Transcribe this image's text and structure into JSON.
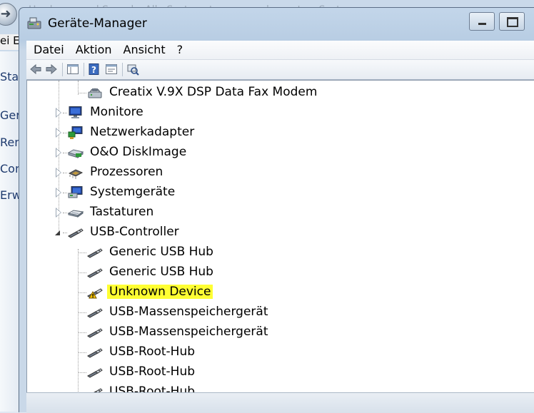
{
  "background": {
    "breadcrumb": "Hardware und Sound  ▸  Alle Systemsteuerungselemente  ▸  System",
    "menu_fragment": "ei   E",
    "side_items": [
      "Sta",
      "Ger",
      "Ren",
      "Con",
      "Erw"
    ]
  },
  "window": {
    "title": "Geräte-Manager",
    "icon": "device-manager-icon"
  },
  "menu": [
    "Datei",
    "Aktion",
    "Ansicht",
    "?"
  ],
  "toolbar": {
    "icons": [
      "back-arrow-icon",
      "forward-arrow-icon",
      "show-hide-console-tree-icon",
      "help-icon",
      "properties-icon",
      "scan-hardware-icon"
    ]
  },
  "tree": [
    {
      "label": "Creatix V.9X DSP Data Fax Modem",
      "level": 2,
      "icon": "modem-icon",
      "expander": "none"
    },
    {
      "label": "Monitore",
      "level": 1,
      "icon": "monitor-icon",
      "expander": "collapsed"
    },
    {
      "label": "Netzwerkadapter",
      "level": 1,
      "icon": "network-adapter-icon",
      "expander": "collapsed"
    },
    {
      "label": "O&O DiskImage",
      "level": 1,
      "icon": "disk-image-icon",
      "expander": "collapsed"
    },
    {
      "label": "Prozessoren",
      "level": 1,
      "icon": "processor-icon",
      "expander": "collapsed"
    },
    {
      "label": "Systemgeräte",
      "level": 1,
      "icon": "system-device-icon",
      "expander": "collapsed"
    },
    {
      "label": "Tastaturen",
      "level": 1,
      "icon": "keyboard-icon",
      "expander": "collapsed"
    },
    {
      "label": "USB-Controller",
      "level": 1,
      "icon": "usb-icon",
      "expander": "expanded"
    },
    {
      "label": "Generic USB Hub",
      "level": 2,
      "icon": "usb-icon",
      "expander": "none"
    },
    {
      "label": "Generic USB Hub",
      "level": 2,
      "icon": "usb-icon",
      "expander": "none"
    },
    {
      "label": "Unknown Device",
      "level": 2,
      "icon": "usb-warning-icon",
      "expander": "none",
      "highlighted": true,
      "highlight_color": "#ffff33"
    },
    {
      "label": "USB-Massenspeichergerät",
      "level": 2,
      "icon": "usb-icon",
      "expander": "none"
    },
    {
      "label": "USB-Massenspeichergerät",
      "level": 2,
      "icon": "usb-icon",
      "expander": "none"
    },
    {
      "label": "USB-Root-Hub",
      "level": 2,
      "icon": "usb-icon",
      "expander": "none"
    },
    {
      "label": "USB-Root-Hub",
      "level": 2,
      "icon": "usb-icon",
      "expander": "none"
    },
    {
      "label": "USB-Root-Hub",
      "level": 2,
      "icon": "usb-icon",
      "expander": "none"
    }
  ],
  "colors": {
    "highlight": "#ffff33",
    "title_bar": "#b8cde3",
    "tree_background": "#ffffff"
  }
}
